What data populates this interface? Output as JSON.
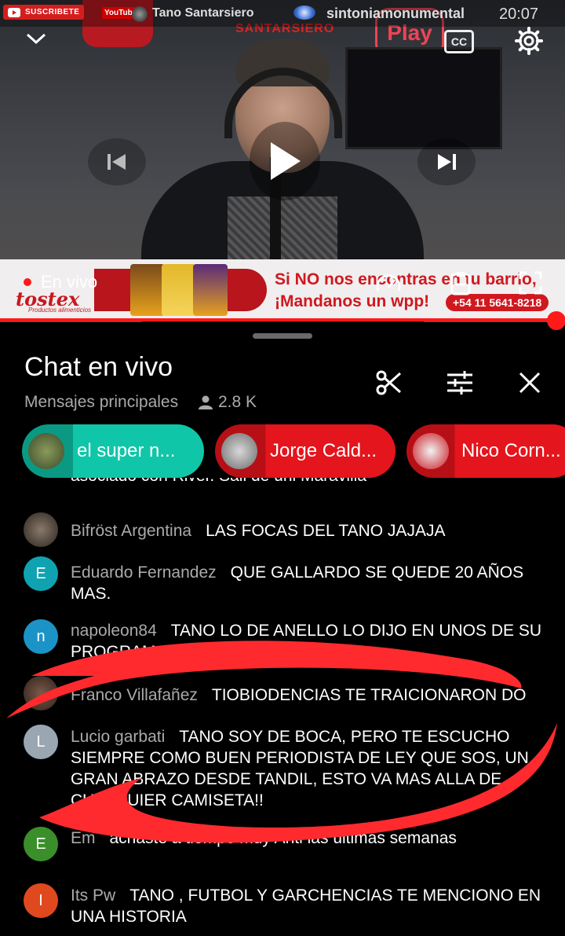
{
  "status_bar": {
    "subscribe_label": "SUSCRIBETE",
    "youtube_mini": "YouTube",
    "channel": "Tano Santarsiero",
    "network": "sintoniamonumental",
    "time": "20:07"
  },
  "player": {
    "play_logo": "Play",
    "studio_logo": "SANTARSIERO",
    "cc_label": "CC",
    "live_label": "En vivo",
    "progress_percent": 98.5
  },
  "banner": {
    "brand": "tostex",
    "brand_sub": "Productos alimenticios",
    "line1": "Si NO nos encontras en tu barrio,",
    "line2": "¡Mandanos un wpp!",
    "phone": "+54 11 5641-8218"
  },
  "chat": {
    "title": "Chat en vivo",
    "subtitle": "Mensajes principales",
    "viewers": "2.8 K",
    "pills": [
      {
        "label": "el super n...",
        "color": "#10c6a8",
        "dark": "#0a9a84"
      },
      {
        "label": "Jorge Cald...",
        "color": "#e4151d",
        "dark": "#b70f16"
      },
      {
        "label": "Nico Corn...",
        "color": "#e4151d",
        "dark": "#b70f16"
      }
    ],
    "clipped_text": "asociado con River. Sali de uni Maravilla",
    "messages": [
      {
        "initial": "",
        "author": "Bifröst Argentina",
        "text": "LAS FOCAS DEL TANO JAJAJA"
      },
      {
        "initial": "E",
        "author": "Eduardo Fernandez",
        "text": "QUE GALLARDO SE QUEDE 20 AÑOS MAS."
      },
      {
        "initial": "n",
        "author": "napoleon84",
        "text": "TANO LO DE ANELLO LO DIJO EN UNOS DE SU PROGRAMAS"
      },
      {
        "initial": "",
        "author": "Franco Villafañez",
        "text": "TIOBIODENCIAS TE TRAICIONARON DO"
      },
      {
        "initial": "L",
        "author": "Lucio garbati",
        "text": "TANO SOY DE BOCA, PERO TE ESCUCHO SIEMPRE COMO BUEN PERIODISTA DE LEY QUE SOS, UN GRAN ABRAZO DESDE TANDIL, ESTO VA MAS ALLA DE CUALQUIER CAMISETA!!"
      },
      {
        "initial": "E",
        "author": "Em",
        "text": "achaste a tiempo muy Anti las ultimas semanas"
      },
      {
        "initial": "I",
        "author": "Its Pw",
        "text": "TANO , FUTBOL Y GARCHENCIAS TE MENCIONO EN UNA HISTORIA"
      }
    ]
  },
  "colors": {
    "accent_red": "#ff1a1a",
    "avatar_teal": "#0fa3b1",
    "avatar_blue": "#1c93c7",
    "avatar_grey": "#9aa6b2",
    "avatar_green": "#3a8f2a",
    "avatar_orange": "#e0491e"
  }
}
